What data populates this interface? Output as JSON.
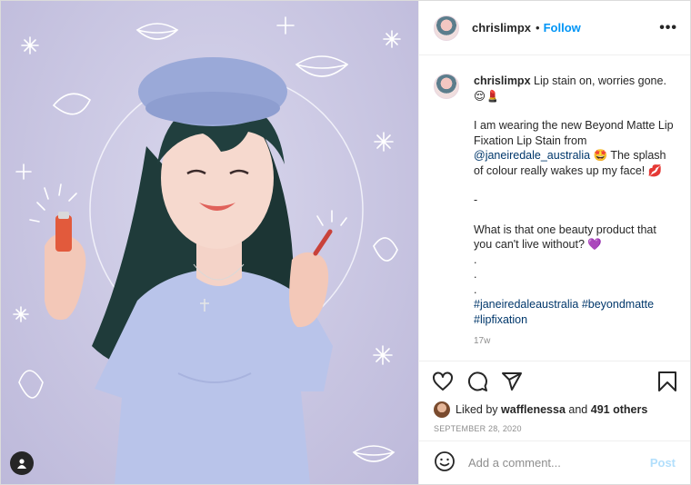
{
  "post": {
    "username": "chrislimpx",
    "follow_label": "Follow",
    "dot": "•",
    "more_label": "•••",
    "caption": {
      "username": "chrislimpx",
      "line1": "Lip stain on, worries gone.",
      "emoji1": "😌💄",
      "para2": "I am wearing the new Beyond Matte Lip Fixation Lip Stain from",
      "mention": "@janeiredale_australia",
      "para2b": "🤩 The splash of colour really wakes up my face! 💋",
      "dash": "-",
      "para3": "What is that one beauty product that you can't live without? 💜",
      "dot1": ".",
      "dot2": ".",
      "dot3": ".",
      "hashtags": "#janeiredaleaustralia #beyondmatte #lipfixation"
    },
    "age": "17w",
    "likes": {
      "prefix": "Liked by",
      "user": "wafflenessa",
      "middle": "and",
      "others": "491 others"
    },
    "date": "SEPTEMBER 28, 2020",
    "comment_placeholder": "Add a comment...",
    "post_label": "Post"
  },
  "icons": {
    "like": "heart-icon",
    "comment": "comment-icon",
    "share": "paper-plane-icon",
    "save": "bookmark-icon",
    "emoji": "smiley-icon",
    "more": "more-options-icon",
    "user_badge": "user-tag-icon"
  },
  "colors": {
    "follow": "#0095f6",
    "post_disabled": "#b2dffc",
    "muted": "#8e8e8e",
    "link": "#00376b"
  }
}
